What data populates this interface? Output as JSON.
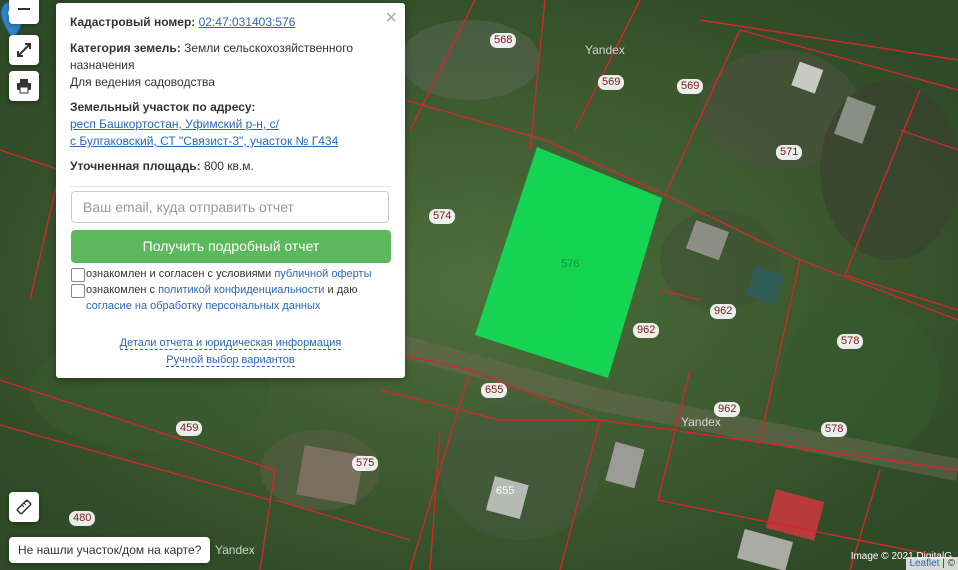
{
  "map": {
    "plot_numbers": [
      "568",
      "569",
      "569",
      "571",
      "574",
      "576",
      "962",
      "962",
      "962",
      "578",
      "578",
      "655",
      "655",
      "459",
      "575",
      "480"
    ],
    "yandex_watermark": "Yandex",
    "colors": {
      "highlight": "#11dd55",
      "boundary": "#d0282c",
      "satellite_dark": "#2f4a27"
    }
  },
  "controls": {
    "zoom_out_icon": "minus-icon",
    "fullscreen_icon": "expand-icon",
    "print_icon": "printer-icon",
    "ruler_icon": "ruler-icon"
  },
  "popup": {
    "cadastral_label": "Кадастровый номер:",
    "cadastral_number": "02:47:031403:576",
    "category_label": "Категория земель:",
    "category_value_1": "Земли сельскохозяйственного",
    "category_value_2": "назначения",
    "category_value_3": "Для ведения садоводства",
    "address_label": "Земельный участок по адресу:",
    "address_line_1": "респ Башкортостан, Уфимский р-н, с/",
    "address_line_2": "с Булгаковский, СТ \"Связист-3\", участок № Г434",
    "area_label": "Уточненная площадь:",
    "area_value": "800 кв.м.",
    "email_placeholder": "Ваш email, куда отправить отчет",
    "get_report_button": "Получить подробный отчет",
    "consent_1_text": "ознакомлен и согласен с условиями ",
    "consent_1_link": "публичной оферты",
    "consent_2_text_a": "ознакомлен с ",
    "consent_2_link_a": "политикой конфиденциальности",
    "consent_2_text_b": " и даю",
    "consent_2_link_b": "согласие на обработку персональных данных",
    "details_link": "Детали отчета и юридическая информация",
    "manual_link": "Ручной выбор вариантов",
    "close_symbol": "×"
  },
  "not_found_text": "Не нашли участок/дом на карте?",
  "attribution": {
    "image_text": "Image © 2021 DigitalG",
    "leaflet": "Leaflet",
    "sep": " | ©"
  }
}
